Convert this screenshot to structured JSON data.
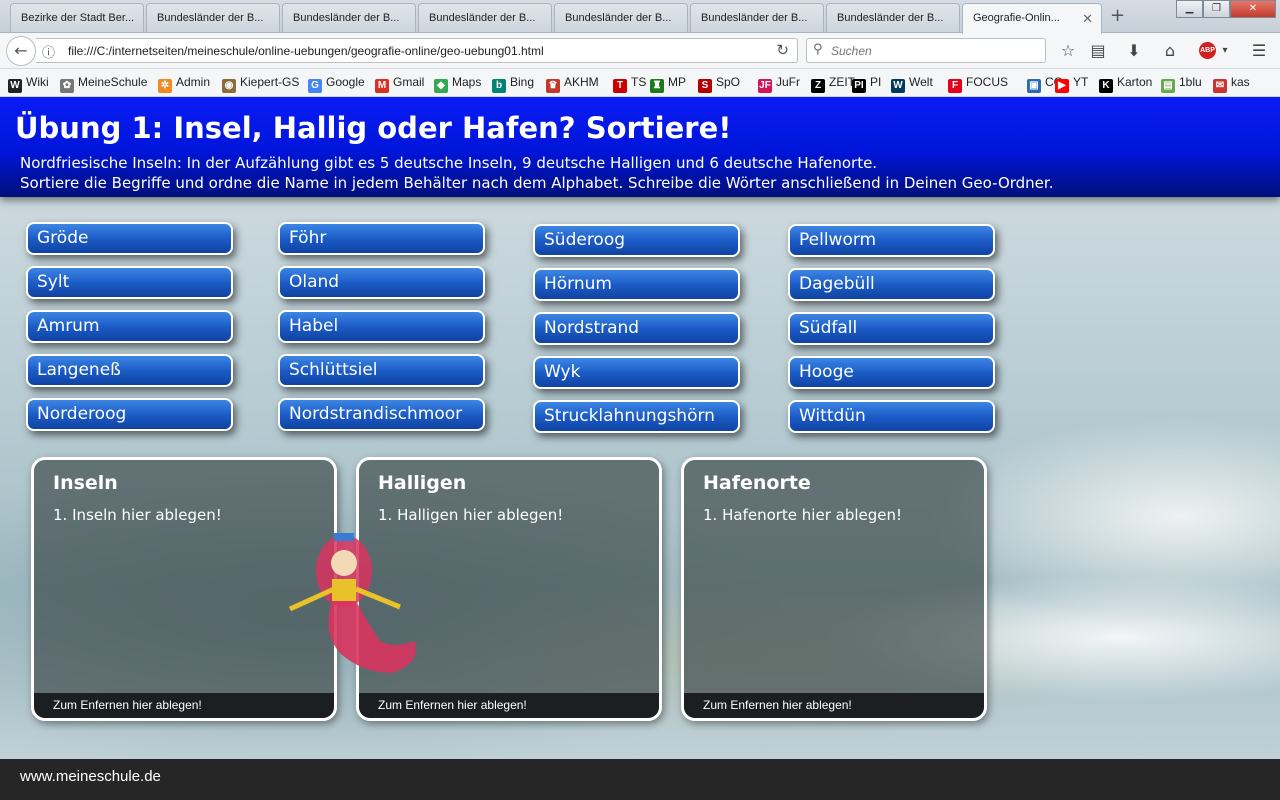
{
  "browser": {
    "tabs": [
      {
        "label": "Bezirke der Stadt Ber..."
      },
      {
        "label": "Bundesländer der B..."
      },
      {
        "label": "Bundesländer der B..."
      },
      {
        "label": "Bundesländer der B..."
      },
      {
        "label": "Bundesländer der B..."
      },
      {
        "label": "Bundesländer der B..."
      },
      {
        "label": "Bundesländer der B..."
      },
      {
        "label": "Geografie-Onlin...",
        "active": true
      }
    ],
    "url": "file:///C:/internetseiten/meineschule/online-uebungen/geografie-online/geo-uebung01.html",
    "search_placeholder": "Suchen",
    "bookmarks": [
      {
        "label": "Wiki",
        "icon": "wikipedia-icon",
        "color": "#222222",
        "glyph": "W"
      },
      {
        "label": "MeineSchule",
        "icon": "school-icon",
        "color": "#777777",
        "glyph": "✿"
      },
      {
        "label": "Admin",
        "icon": "joomla-icon",
        "color": "#f08a24",
        "glyph": "✲"
      },
      {
        "label": "Kiepert-GS",
        "icon": "globe-icon",
        "color": "#8a6d3b",
        "glyph": "◉"
      },
      {
        "label": "Google",
        "icon": "google-icon",
        "color": "#4285f4",
        "glyph": "G"
      },
      {
        "label": "Gmail",
        "icon": "gmail-icon",
        "color": "#d93025",
        "glyph": "M"
      },
      {
        "label": "Maps",
        "icon": "maps-icon",
        "color": "#34a853",
        "glyph": "◆"
      },
      {
        "label": "Bing",
        "icon": "bing-icon",
        "color": "#008373",
        "glyph": "b"
      },
      {
        "label": "AKHM",
        "icon": "crest-icon",
        "color": "#c0392b",
        "glyph": "♛"
      },
      {
        "label": "TS",
        "icon": "ts-icon",
        "color": "#cc0000",
        "glyph": "T"
      },
      {
        "label": "MP",
        "icon": "mp-icon",
        "color": "#1e7a1e",
        "glyph": "♜"
      },
      {
        "label": "SpO",
        "icon": "spiegel-icon",
        "color": "#b30000",
        "glyph": "S"
      },
      {
        "label": "JuFr",
        "icon": "jufr-icon",
        "color": "#d4145a",
        "glyph": "JF"
      },
      {
        "label": "ZEIT",
        "icon": "zeit-icon",
        "color": "#000000",
        "glyph": "Z"
      },
      {
        "label": "PI",
        "icon": "pi-icon",
        "color": "#000000",
        "glyph": "PI"
      },
      {
        "label": "Welt",
        "icon": "welt-icon",
        "color": "#003a5d",
        "glyph": "W"
      },
      {
        "label": "FOCUS",
        "icon": "focus-icon",
        "color": "#e2001a",
        "glyph": "F"
      },
      {
        "label": "CG",
        "icon": "cube-icon",
        "color": "#2b6cb0",
        "glyph": "▣"
      },
      {
        "label": "YT",
        "icon": "youtube-icon",
        "color": "#ff0000",
        "glyph": "▶"
      },
      {
        "label": "Karton",
        "icon": "karton-icon",
        "color": "#000000",
        "glyph": "K"
      },
      {
        "label": "1blu",
        "icon": "1blu-icon",
        "color": "#6aa84f",
        "glyph": "▤"
      },
      {
        "label": "kas",
        "icon": "kas-icon",
        "color": "#cc3333",
        "glyph": "✉"
      }
    ]
  },
  "header": {
    "title": "Übung 1: Insel, Hallig oder Hafen? Sortiere!",
    "line1": "Nordfriesische Inseln: In der Aufzählung gibt es 5 deutsche Inseln, 9 deutsche Halligen und 6 deutsche Hafenorte.",
    "line2": "Sortiere die Begriffe und ordne die Name in jedem Behälter nach dem Alphabet. Schreibe die Wörter anschließend in Deinen Geo-Ordner."
  },
  "words": [
    [
      "Gröde",
      "Sylt",
      "Amrum",
      "Langeneß",
      "Norderoog"
    ],
    [
      "Föhr",
      "Oland",
      "Habel",
      "Schlüttsiel",
      "Nordstrandischmoor"
    ],
    [
      "Süderoog",
      "Hörnum",
      "Nordstrand",
      "Wyk",
      "Strucklahnungshörn"
    ],
    [
      "Pellworm",
      "Dagebüll",
      "Südfall",
      "Hooge",
      "Wittdün"
    ]
  ],
  "bins": [
    {
      "title": "Inseln",
      "placeholder": "Inseln hier ablegen!",
      "footer": "Zum Enfernen hier ablegen!"
    },
    {
      "title": "Halligen",
      "placeholder": "Halligen hier ablegen!",
      "footer": "Zum Enfernen hier ablegen!"
    },
    {
      "title": "Hafenorte",
      "placeholder": "Hafenorte hier ablegen!",
      "footer": "Zum Enfernen hier ablegen!"
    }
  ],
  "bin_item_number": "1.",
  "footer": {
    "url": "www.meineschule.de"
  },
  "colors": {
    "header_blue": "#0015d9",
    "button_blue": "#1c5cc7",
    "footer_bg": "#262626"
  }
}
